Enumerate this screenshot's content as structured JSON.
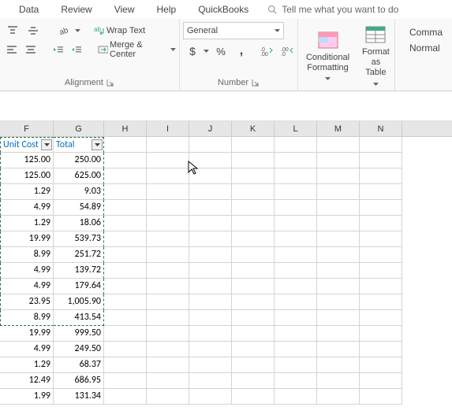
{
  "menu": {
    "data": "Data",
    "review": "Review",
    "view": "View",
    "help": "Help",
    "qb": "QuickBooks",
    "tellme": "Tell me what you want to do"
  },
  "ribbon": {
    "alignment": {
      "wrap": "Wrap Text",
      "merge": "Merge & Center",
      "label": "Alignment"
    },
    "number": {
      "format": "General",
      "label": "Number"
    },
    "styles": {
      "cond": "Conditional",
      "cond2": "Formatting",
      "fmt": "Format as",
      "fmt2": "Table"
    },
    "cell_styles": {
      "s1": "Comma",
      "s2": "Normal"
    }
  },
  "columns": [
    "F",
    "G",
    "H",
    "I",
    "J",
    "K",
    "L",
    "M",
    "N"
  ],
  "table_hdr": {
    "f": "Unit Cost",
    "g": "Total"
  },
  "rows": [
    {
      "f": "125.00",
      "g": "250.00",
      "sel": true
    },
    {
      "f": "125.00",
      "g": "625.00",
      "sel": true
    },
    {
      "f": "1.29",
      "g": "9.03",
      "sel": true
    },
    {
      "f": "4.99",
      "g": "54.89",
      "sel": true
    },
    {
      "f": "1.29",
      "g": "18.06",
      "sel": true
    },
    {
      "f": "19.99",
      "g": "539.73",
      "sel": true
    },
    {
      "f": "8.99",
      "g": "251.72",
      "sel": true
    },
    {
      "f": "4.99",
      "g": "139.72",
      "sel": true
    },
    {
      "f": "4.99",
      "g": "179.64",
      "sel": true
    },
    {
      "f": "23.95",
      "g": "1,005.90",
      "sel": true
    },
    {
      "f": "8.99",
      "g": "413.54",
      "sel": true,
      "last": true
    },
    {
      "f": "19.99",
      "g": "999.50",
      "sel": false
    },
    {
      "f": "4.99",
      "g": "249.50",
      "sel": false
    },
    {
      "f": "1.29",
      "g": "68.37",
      "sel": false
    },
    {
      "f": "12.49",
      "g": "686.95",
      "sel": false
    },
    {
      "f": "1.99",
      "g": "131.34",
      "sel": false
    }
  ]
}
